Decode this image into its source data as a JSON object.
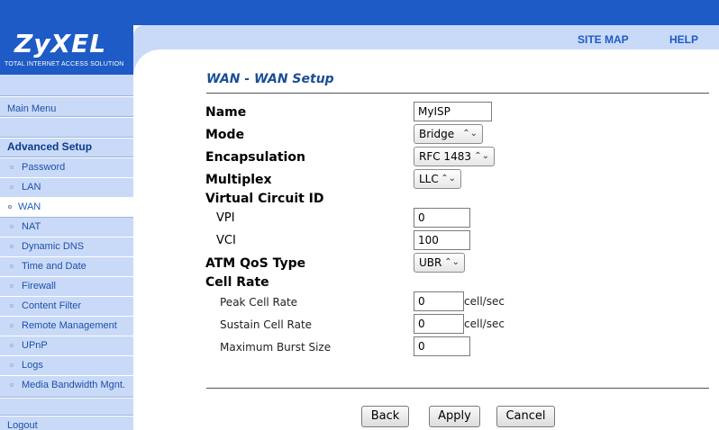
{
  "header": {
    "logo_text": "ZyXEL",
    "logo_tagline": "TOTAL INTERNET ACCESS SOLUTION",
    "site_map": "SITE MAP",
    "help": "HELP"
  },
  "sidebar": {
    "main_menu": "Main Menu",
    "section": "Advanced Setup",
    "items": [
      "Password",
      "LAN",
      "WAN",
      "NAT",
      "Dynamic DNS",
      "Time and Date",
      "Firewall",
      "Content Filter",
      "Remote Management",
      "UPnP",
      "Logs",
      "Media Bandwidth Mgnt."
    ],
    "active": "WAN",
    "logout": "Logout"
  },
  "page": {
    "title": "WAN - WAN Setup"
  },
  "form": {
    "name_label": "Name",
    "name_value": "MyISP",
    "mode_label": "Mode",
    "mode_value": "Bridge",
    "encapsulation_label": "Encapsulation",
    "encapsulation_value": "RFC 1483",
    "multiplex_label": "Multiplex",
    "multiplex_value": "LLC",
    "vcid_label": "Virtual Circuit ID",
    "vpi_label": "VPI",
    "vpi_value": "0",
    "vci_label": "VCI",
    "vci_value": "100",
    "qos_label": "ATM QoS Type",
    "qos_value": "UBR",
    "cell_rate_label": "Cell Rate",
    "pcr_label": "Peak Cell Rate",
    "pcr_value": "0",
    "scr_label": "Sustain Cell Rate",
    "scr_value": "0",
    "mbs_label": "Maximum Burst Size",
    "mbs_value": "0",
    "unit": "cell/sec"
  },
  "buttons": {
    "back": "Back",
    "apply": "Apply",
    "cancel": "Cancel"
  },
  "colors": {
    "brand_blue": "#1e5bc6",
    "nav_light": "#c9daf8",
    "title_blue": "#1a4e96"
  }
}
